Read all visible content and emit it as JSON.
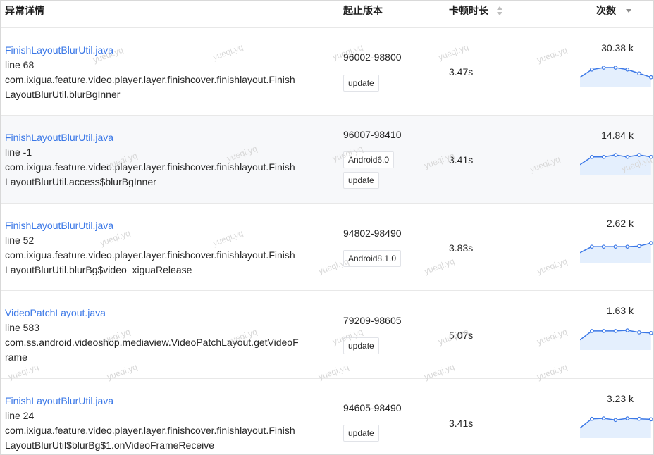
{
  "columns": {
    "detail": "异常详情",
    "version": "起止版本",
    "duration": "卡顿时长",
    "count": "次数"
  },
  "watermark": "yueqi.yq",
  "rows": [
    {
      "file": "FinishLayoutBlurUtil.java",
      "line": "line 68",
      "stack1": "com.ixigua.feature.video.player.layer.finishcover.finishlayout.Finish",
      "stack2": "LayoutBlurUtil.blurBgInner",
      "version": "96002-98800",
      "tags": [
        "update"
      ],
      "duration": "3.47s",
      "count": "30.38 k",
      "trend": [
        22,
        26,
        27,
        27,
        26,
        24,
        22
      ]
    },
    {
      "file": "FinishLayoutBlurUtil.java",
      "line": "line -1",
      "stack1": "com.ixigua.feature.video.player.layer.finishcover.finishlayout.Finish",
      "stack2": "LayoutBlurUtil.access$blurBgInner",
      "version": "96007-98410",
      "tags": [
        "Android6.0",
        "update"
      ],
      "duration": "3.41s",
      "count": "14.84 k",
      "trend": [
        10,
        14,
        14,
        15,
        14,
        15,
        14
      ]
    },
    {
      "file": "FinishLayoutBlurUtil.java",
      "line": "line 52",
      "stack1": "com.ixigua.feature.video.player.layer.finishcover.finishlayout.Finish",
      "stack2": "LayoutBlurUtil.blurBg$video_xiguaRelease",
      "version": "94802-98490",
      "tags": [
        "Android8.1.0"
      ],
      "duration": "3.83s",
      "count": "2.62 k",
      "trend": [
        1.8,
        2.3,
        2.3,
        2.3,
        2.3,
        2.35,
        2.6
      ]
    },
    {
      "file": "VideoPatchLayout.java",
      "line": "line 583",
      "stack1": "com.ss.android.videoshop.mediaview.VideoPatchLayout.getVideoF",
      "stack2": "rame",
      "version": "79209-98605",
      "tags": [
        "update"
      ],
      "duration": "5.07s",
      "count": "1.63 k",
      "trend": [
        0.9,
        1.35,
        1.35,
        1.35,
        1.38,
        1.28,
        1.25
      ]
    },
    {
      "file": "FinishLayoutBlurUtil.java",
      "line": "line 24",
      "stack1": "com.ixigua.feature.video.player.layer.finishcover.finishlayout.Finish",
      "stack2": "LayoutBlurUtil$blurBg$1.onVideoFrameReceive",
      "version": "94605-98490",
      "tags": [
        "update"
      ],
      "duration": "3.41s",
      "count": "3.23 k",
      "trend": [
        2.3,
        2.7,
        2.72,
        2.65,
        2.72,
        2.7,
        2.68
      ]
    }
  ],
  "colors": {
    "link": "#3b78e7",
    "line": "#3b78e7",
    "area": "#e4effd"
  }
}
